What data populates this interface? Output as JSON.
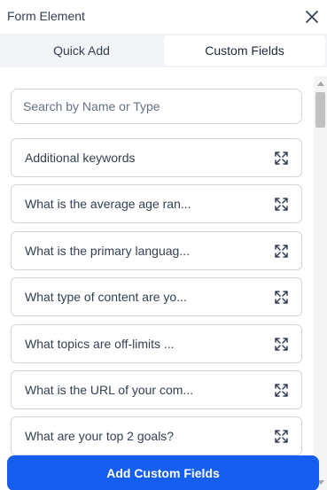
{
  "header": {
    "title": "Form Element"
  },
  "tabs": [
    {
      "label": "Quick Add",
      "active": false
    },
    {
      "label": "Custom Fields",
      "active": true
    }
  ],
  "search": {
    "placeholder": "Search by Name or Type",
    "value": ""
  },
  "fields": [
    {
      "label": "Additional keywords"
    },
    {
      "label": "What is the average age ran..."
    },
    {
      "label": "What is the primary languag..."
    },
    {
      "label": "What type of content are yo..."
    },
    {
      "label": "What topics are off-limits ..."
    },
    {
      "label": "What is the URL of your com..."
    },
    {
      "label": "What are your top 2 goals?"
    }
  ],
  "primary_action": {
    "label": "Add Custom Fields"
  },
  "colors": {
    "accent": "#155eef",
    "border": "#d0d5dd",
    "text": "#344054"
  }
}
